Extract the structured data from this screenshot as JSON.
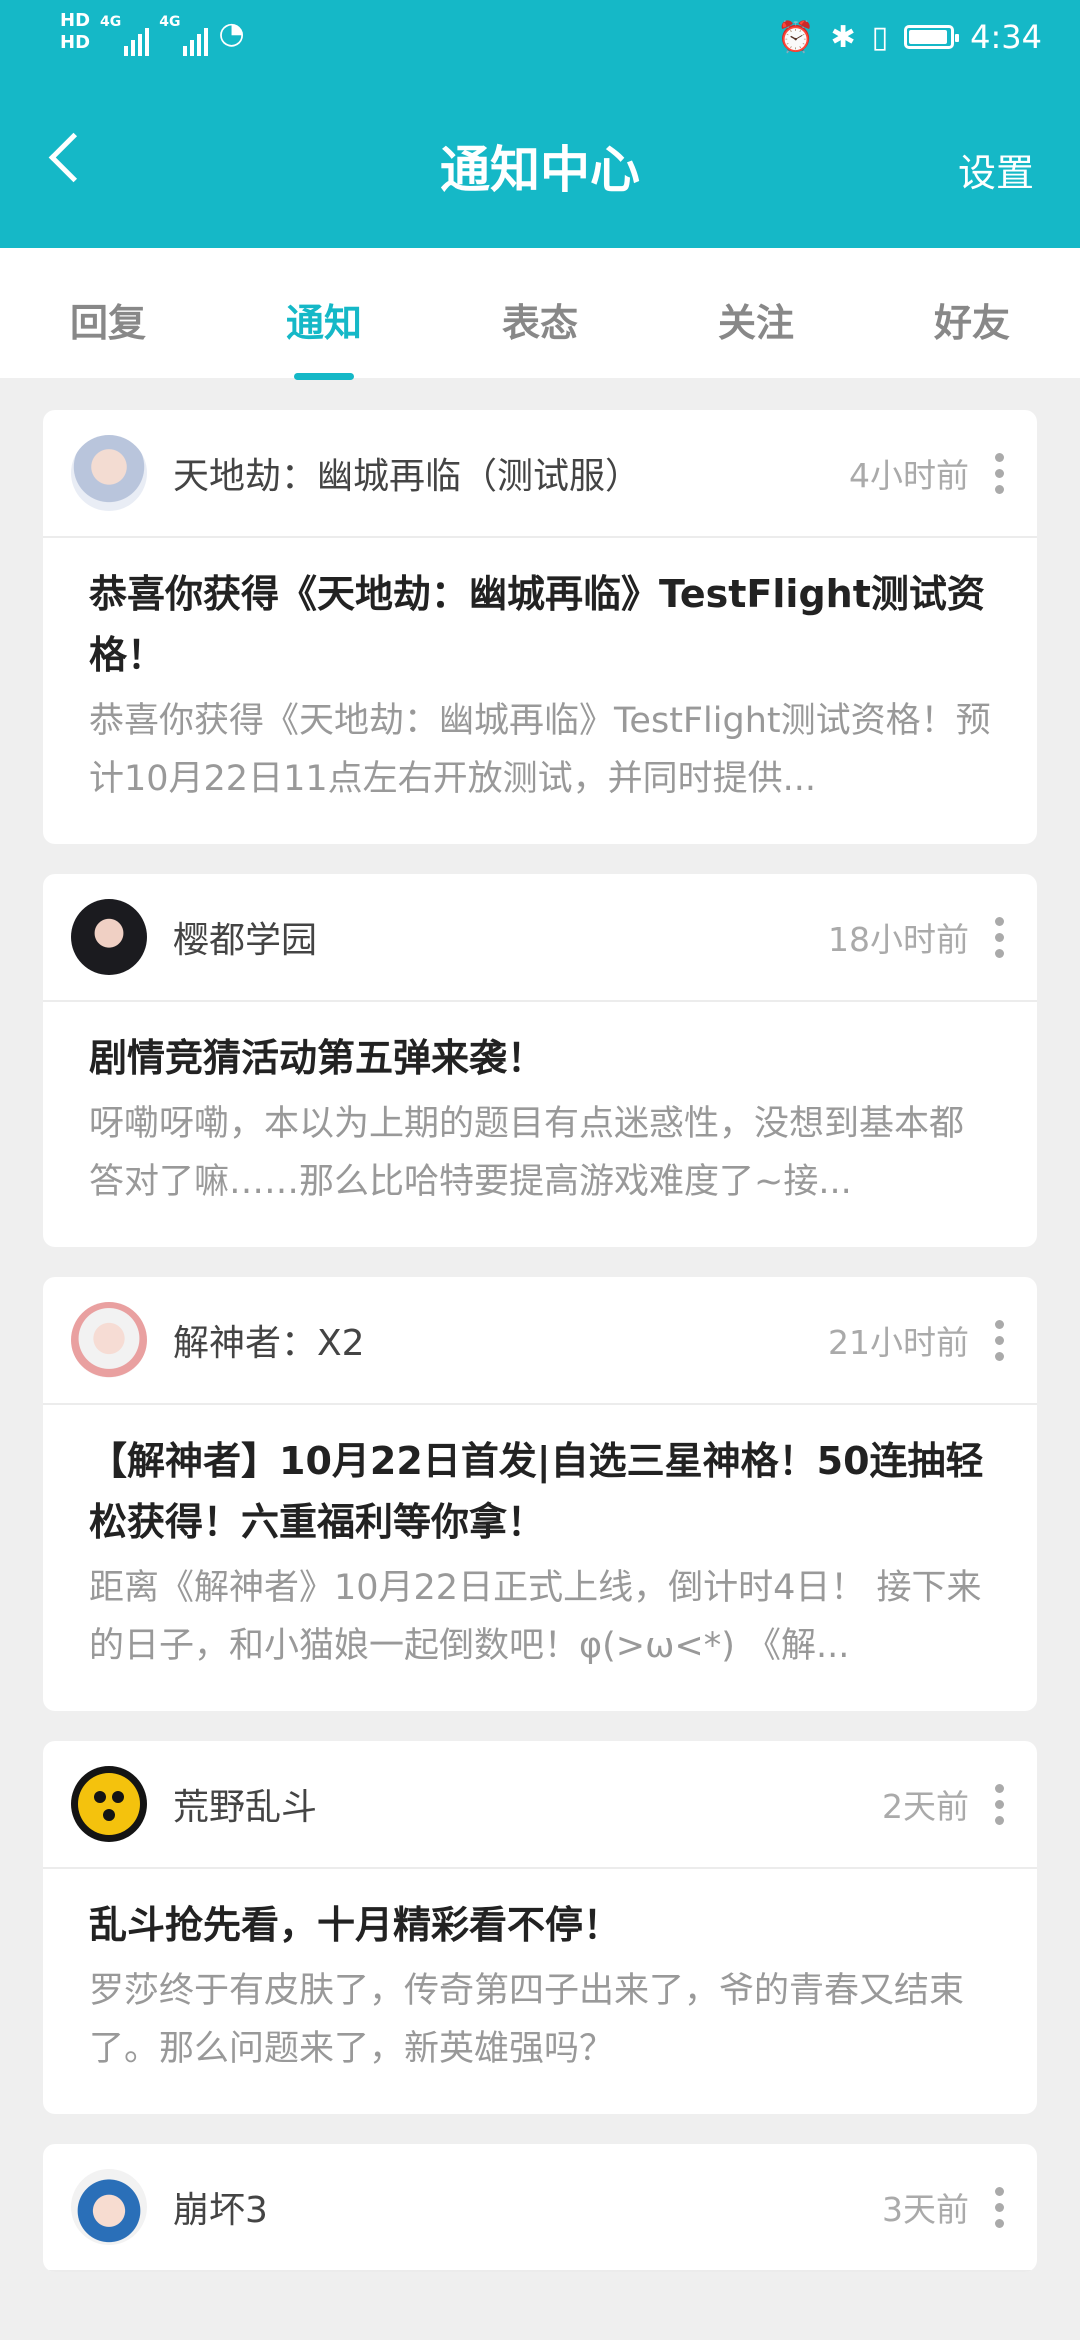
{
  "status_bar": {
    "hd1": "HD",
    "hd2": "HD",
    "sim1": "4G",
    "sim2": "4G",
    "time": "4:34",
    "icons": [
      "alarm-icon",
      "bluetooth-icon",
      "vibrate-icon",
      "battery-icon"
    ]
  },
  "nav": {
    "title": "通知中心",
    "settings_label": "设置"
  },
  "tabs": [
    {
      "label": "回复",
      "active": false
    },
    {
      "label": "通知",
      "active": true
    },
    {
      "label": "表态",
      "active": false
    },
    {
      "label": "关注",
      "active": false
    },
    {
      "label": "好友",
      "active": false
    }
  ],
  "notifications": [
    {
      "app": "天地劫：幽城再临（测试服）",
      "time": "4小时前",
      "title": "恭喜你获得《天地劫：幽城再临》TestFlight测试资格！",
      "desc": "恭喜你获得《天地劫：幽城再临》TestFlight测试资格！预计10月22日11点左右开放测试，并同时提供..."
    },
    {
      "app": "樱都学园",
      "time": "18小时前",
      "title": "剧情竞猜活动第五弹来袭！",
      "desc": "呀嘞呀嘞，本以为上期的题目有点迷惑性，没想到基本都答对了嘛……那么比哈特要提高游戏难度了~接..."
    },
    {
      "app": "解神者：X2",
      "time": "21小时前",
      "title": "【解神者】10月22日首发|自选三星神格！50连抽轻松获得！六重福利等你拿！",
      "desc": "距离《解神者》10月22日正式上线，倒计时4日！ 接下来的日子，和小猫娘一起倒数吧！φ(>ω<*) 《解..."
    },
    {
      "app": "荒野乱斗",
      "time": "2天前",
      "title": "乱斗抢先看，十月精彩看不停！",
      "desc": "罗莎终于有皮肤了，传奇第四子出来了，爷的青春又结束了。那么问题来了，新英雄强吗？"
    },
    {
      "app": "崩坏3",
      "time": "3天前",
      "title": "",
      "desc": ""
    }
  ]
}
